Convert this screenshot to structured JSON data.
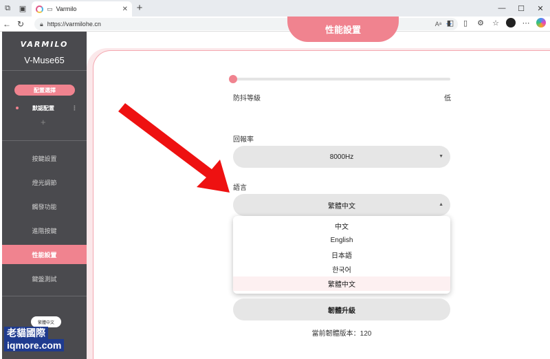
{
  "browser": {
    "tab_title": "Varmilo",
    "url": "https://varmilohe.cn",
    "new_tab": "+",
    "tab_close": "✕"
  },
  "sidebar": {
    "brand": "VARMILO",
    "model": "V-Muse65",
    "config_button": "配置選擇",
    "config_item": "默認配置",
    "config_item_more": "⋮",
    "config_add": "+",
    "menu": [
      {
        "label": "按鍵設置"
      },
      {
        "label": "燈光調節"
      },
      {
        "label": "觸發功能"
      },
      {
        "label": "進階按鍵"
      },
      {
        "label": "性能設置",
        "active": true
      },
      {
        "label": "鍵盤測試"
      }
    ],
    "language_pill": "繁體中文"
  },
  "main": {
    "section_title": "性能設置",
    "debounce_label": "防抖等級",
    "debounce_value": "低",
    "debounce_level_fraction": 0.0,
    "polling_label": "回報率",
    "polling_value": "8000Hz",
    "language_label": "語言",
    "language_value": "繁體中文",
    "language_options": [
      "中文",
      "English",
      "日本語",
      "한국어",
      "繁體中文"
    ],
    "language_selected_index": 4,
    "firmware_button": "韌體升級",
    "firmware_version": "當前韌體版本：120"
  },
  "watermark": {
    "line1": "老貓國際",
    "line2": "iqmore.com"
  },
  "colors": {
    "accent": "#f0838f",
    "sidebar_bg": "#4a4a4e",
    "arrow": "#ee1111"
  }
}
